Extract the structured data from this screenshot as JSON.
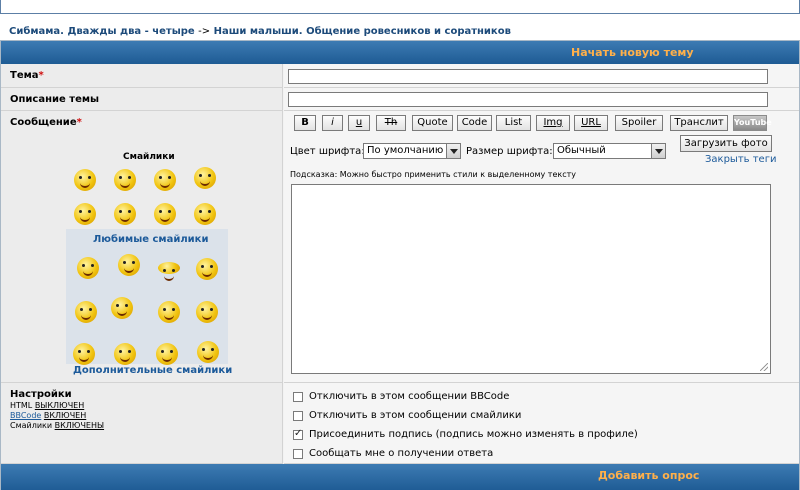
{
  "breadcrumb": {
    "forum": "Сибмама. Дважды два - четыре",
    "separator": "->",
    "section": "Наши малыши. Общение ровесников и соратников"
  },
  "header": {
    "title": "Начать новую тему"
  },
  "fields": {
    "topic_label": "Тема",
    "topic_value": "",
    "description_label": "Описание темы",
    "description_value": "",
    "message_label": "Сообщение",
    "required_mark": "*"
  },
  "toolbar": {
    "buttons": [
      "B",
      "i",
      "u",
      "Th",
      "Quote",
      "Code",
      "List",
      "Img",
      "URL",
      "Spoiler",
      "Транслит"
    ],
    "youtube": "YouTube",
    "font_color_label": "Цвет шрифта:",
    "font_color_value": "По умолчанию",
    "font_size_label": "Размер шрифта:",
    "font_size_value": "Обычный",
    "upload_label": "Загрузить фото",
    "close_tags_label": "Закрыть теги",
    "hint": "Подсказка: Можно быстро применить стили к выделенному тексту"
  },
  "smileys": {
    "title": "Смайлики",
    "favorites_label": "Любимые смайлики",
    "more_label": "Дополнительные смайлики"
  },
  "settings": {
    "title": "Настройки",
    "html_label": "HTML",
    "html_state": "ВЫКЛЮЧЕН",
    "bbcode_label": "BBCode",
    "bbcode_state": "ВКЛЮЧЕН",
    "smileys_label": "Смайлики",
    "smileys_state": "ВКЛЮЧЕНЫ"
  },
  "options": [
    {
      "label": "Отключить в этом сообщении BBCode",
      "checked": false
    },
    {
      "label": "Отключить в этом сообщении смайлики",
      "checked": false
    },
    {
      "label": "Присоединить подпись (подпись можно изменять в профиле)",
      "checked": true
    },
    {
      "label": "Сообщать мне о получении ответа",
      "checked": false
    }
  ],
  "footer": {
    "title": "Добавить опрос"
  },
  "colors": {
    "bar": "#2a68a3",
    "bar_text": "#ffb04a",
    "link": "#1c5a9a",
    "required": "#d01010"
  }
}
